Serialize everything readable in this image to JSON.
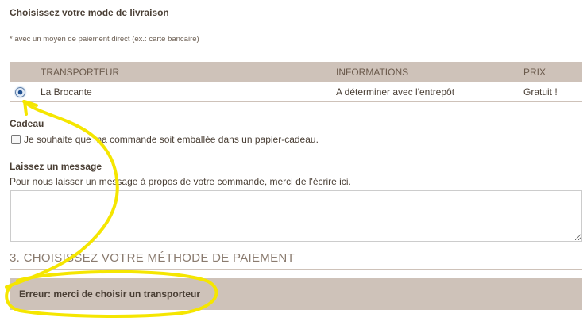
{
  "delivery": {
    "title": "Choisissez votre mode de livraison",
    "note": "* avec un moyen de paiement direct (ex.: carte bancaire)",
    "columns": [
      "TRANSPORTEUR",
      "INFORMATIONS",
      "PRIX"
    ],
    "carriers": [
      {
        "name": "La Brocante",
        "info": "A déterminer avec l'entrepôt",
        "price": "Gratuit !",
        "selected": true
      }
    ]
  },
  "gift": {
    "heading": "Cadeau",
    "checkbox_label": "Je souhaite que ma commande soit emballée dans un papier-cadeau.",
    "checked": false
  },
  "message": {
    "heading": "Laissez un message",
    "help": "Pour nous laisser un message à propos de votre commande, merci de l'écrire ici.",
    "value": ""
  },
  "payment": {
    "section_title": "3. CHOISISSEZ VOTRE MÉTHODE DE PAIEMENT",
    "error": "Erreur: merci de choisir un transporteur"
  },
  "colors": {
    "panel": "#cec2b9",
    "annotation": "#f5e600"
  }
}
